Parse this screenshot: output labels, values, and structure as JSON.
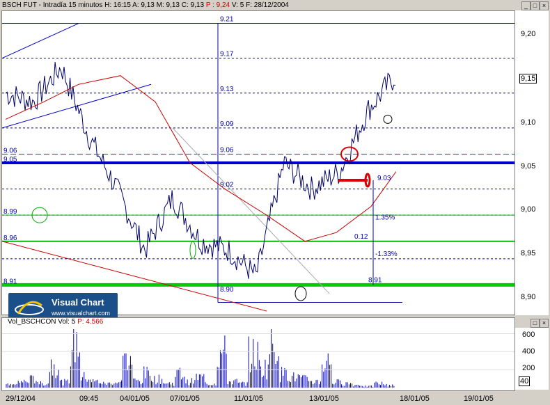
{
  "header": {
    "symbol": "BSCH FUT",
    "period": "Intradía 15 minutos",
    "h_label": "H:",
    "time": "16:15",
    "a_label": "A:",
    "open": "9,13",
    "m_label": "M:",
    "low": "9,13",
    "c_label": "C:",
    "close": "9,13",
    "p_label": "P :",
    "p_value": "9,24",
    "v_label": "V:",
    "volume": "5",
    "f_label": "F:",
    "date": "28/12/2004"
  },
  "price_axis": {
    "ticks": [
      "9,20",
      "9,15",
      "9,10",
      "9,05",
      "9,00",
      "8,95",
      "8,90"
    ],
    "current_badge": "9,15"
  },
  "volume_panel": {
    "title": "Vol_BSCHCON",
    "vol_label": "Vol:",
    "vol_value": "5",
    "p_label": "P:",
    "p_value": "4.566",
    "ticks": [
      "600",
      "400",
      "200"
    ],
    "current_badge": "40"
  },
  "x_axis": {
    "labels": [
      "29/12/04",
      "09:45",
      "04/01/05",
      "07/01/05",
      "11/01/05",
      "13/01/05",
      "18/01/05",
      "19/01/05"
    ]
  },
  "annotations": {
    "left_levels": [
      "9.06",
      "9.05",
      "8.99",
      "8.96",
      "8.91"
    ],
    "center_levels": [
      "9.21",
      "9.17",
      "9.13",
      "9.09",
      "9.06",
      "9.02",
      "8.90"
    ],
    "fib_labels": [
      "9.03",
      "1.35%",
      "0.12",
      "-1.33%",
      "8.91"
    ]
  },
  "logo": {
    "brand": "Visual Chart",
    "url": "www.visualchart.com"
  },
  "colors": {
    "price_line": "#000066",
    "moving_average": "#cc0000",
    "support_blue": "#0000cc",
    "support_green": "#00cc00",
    "volume_bars": "#0000cc"
  },
  "chart_data": [
    {
      "type": "line",
      "title": "BSCH FUT - Intradía 15 minutos",
      "x": [
        "29/12/04",
        "09:45",
        "04/01/05",
        "07/01/05",
        "11/01/05",
        "13/01/05",
        "18/01/05"
      ],
      "ylim": [
        8.88,
        9.22
      ],
      "series": [
        {
          "name": "BSCH FUT",
          "values": [
            9.13,
            9.12,
            9.16,
            9.08,
            9.02,
            8.95,
            9.01,
            8.96,
            8.95,
            8.92,
            9.05,
            9.02,
            9.04,
            9.11,
            9.15
          ]
        }
      ],
      "grid": true
    },
    {
      "type": "bar",
      "title": "Vol_BSCHCON",
      "ylim": [
        0,
        650
      ],
      "values": [
        40,
        90,
        120,
        60,
        350,
        80,
        660,
        150,
        90,
        60,
        80,
        380,
        100,
        200,
        120,
        60,
        200,
        90,
        150,
        60,
        500,
        90,
        60,
        480,
        300,
        640,
        200,
        150,
        120,
        90,
        380,
        80,
        60,
        40,
        20,
        60,
        40
      ]
    }
  ]
}
